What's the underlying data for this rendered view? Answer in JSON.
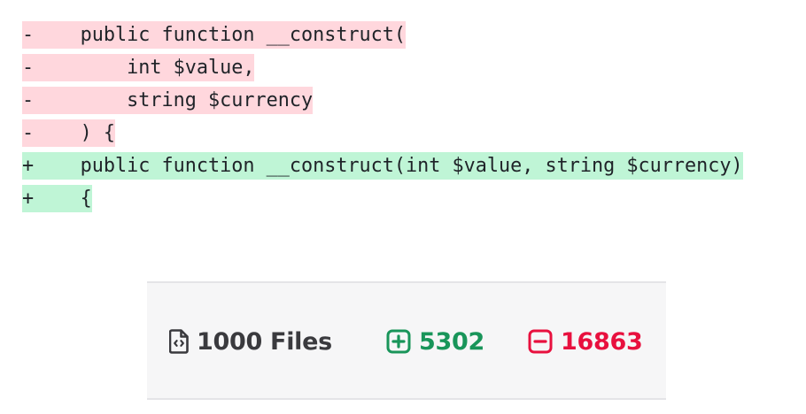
{
  "diff": {
    "lines": [
      {
        "type": "del",
        "text": "-    public function __construct("
      },
      {
        "type": "del",
        "text": "-        int $value,"
      },
      {
        "type": "del",
        "text": "-        string $currency"
      },
      {
        "type": "del",
        "text": "-    ) {"
      },
      {
        "type": "add",
        "text": "+    public function __construct(int $value, string $currency)"
      },
      {
        "type": "add",
        "text": "+    {"
      }
    ]
  },
  "stats": {
    "files_label": "1000 Files",
    "additions": "5302",
    "deletions": "16863",
    "colors": {
      "files": "#3a3a3e",
      "additions": "#19955a",
      "deletions": "#e8103e",
      "deleted_line_bg": "#ffd7dd",
      "added_line_bg": "#bff5d6"
    },
    "icons": {
      "files": "file-code-icon",
      "additions": "plus-square-icon",
      "deletions": "minus-square-icon"
    }
  }
}
